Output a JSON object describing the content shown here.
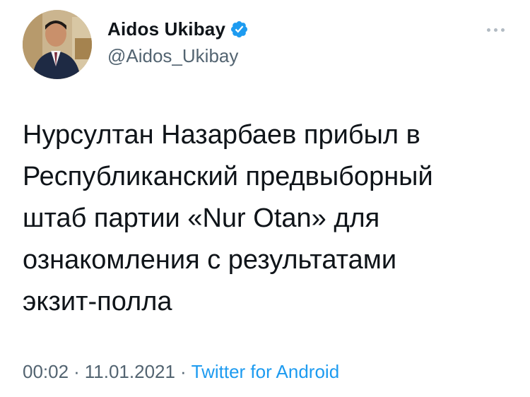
{
  "author": {
    "display_name": "Aidos Ukibay",
    "handle": "@Aidos_Ukibay",
    "verified": true,
    "verified_color": "#1d9bf0"
  },
  "menu_icon": "more-horizontal-icon",
  "tweet": {
    "lines": [
      "Нурсултан Назарбаев прибыл в",
      "Республиканский предвыборный",
      "штаб партии «Nur Otan» для",
      "ознакомления с результатами",
      "экзит-полла"
    ]
  },
  "meta": {
    "time": "00:02",
    "separator": "·",
    "date": "11.01.2021",
    "source": "Twitter for Android",
    "source_color": "#1d9bf0"
  }
}
